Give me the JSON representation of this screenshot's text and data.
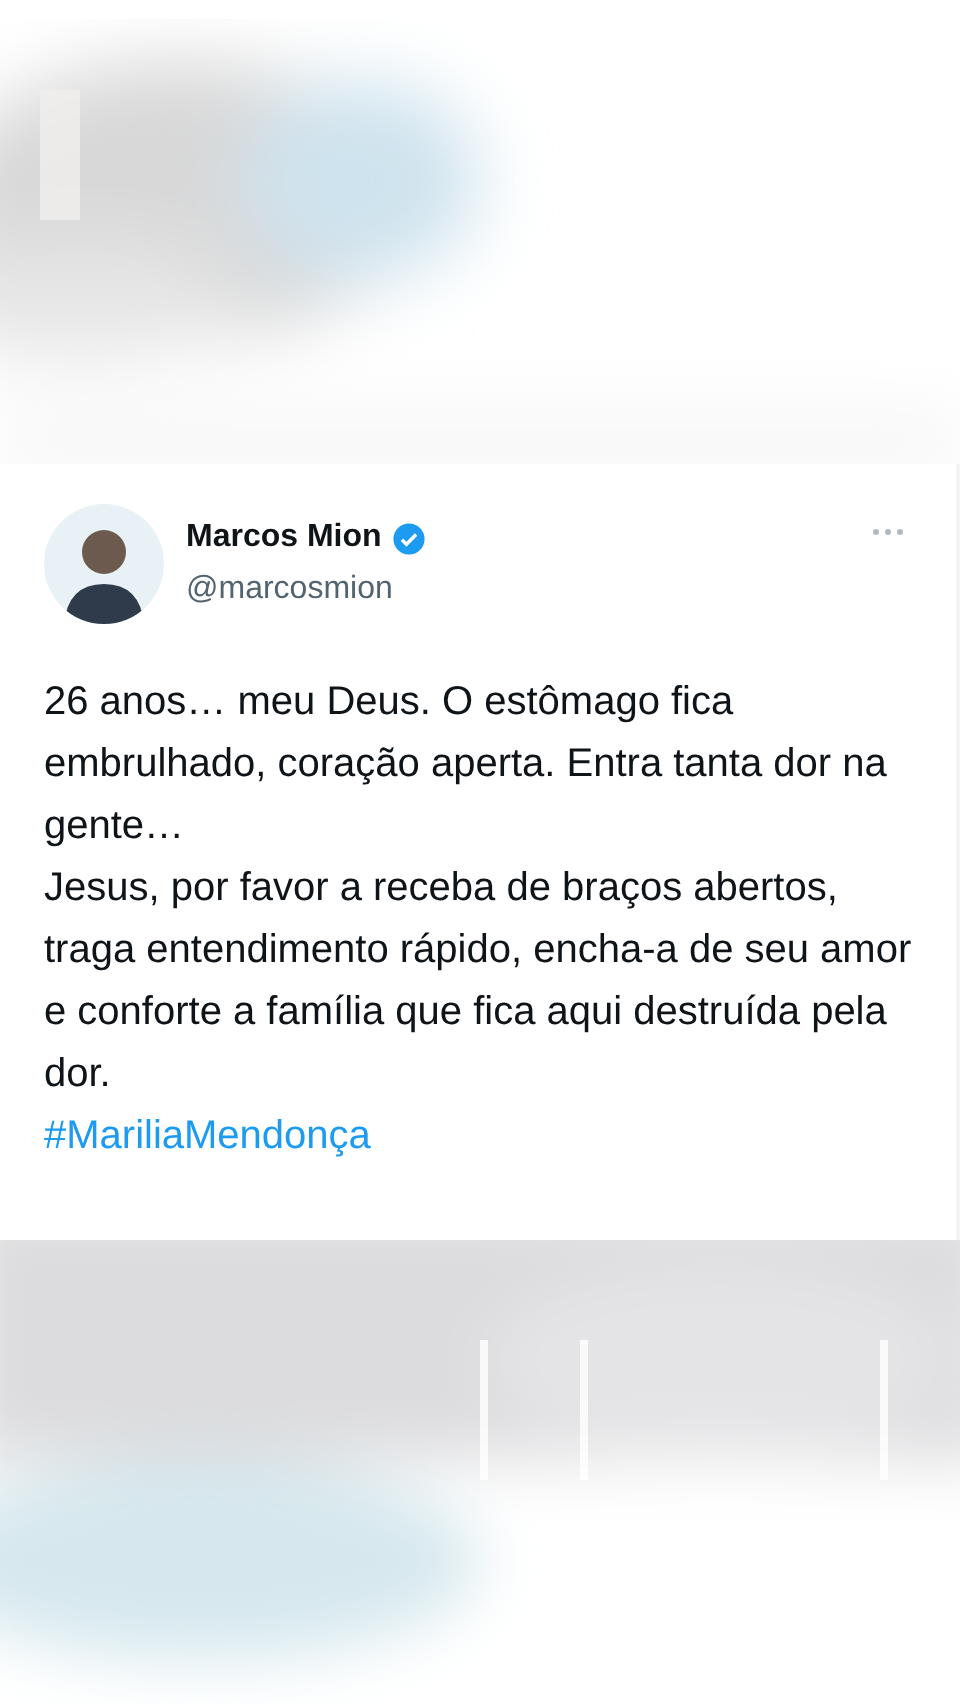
{
  "tweet": {
    "name": "Marcos Mion",
    "verified": true,
    "handle": "@marcosmion",
    "paragraphs": [
      "26 anos… meu Deus. O estômago fica embrulhado, coração aperta. Entra tanta dor na gente…",
      "Jesus, por favor a receba de braços abertos, traga entendimento rápido, encha-a de seu amor e conforte a família que fica aqui destruída pela dor."
    ],
    "hashtag": "#MariliaMendonça"
  }
}
